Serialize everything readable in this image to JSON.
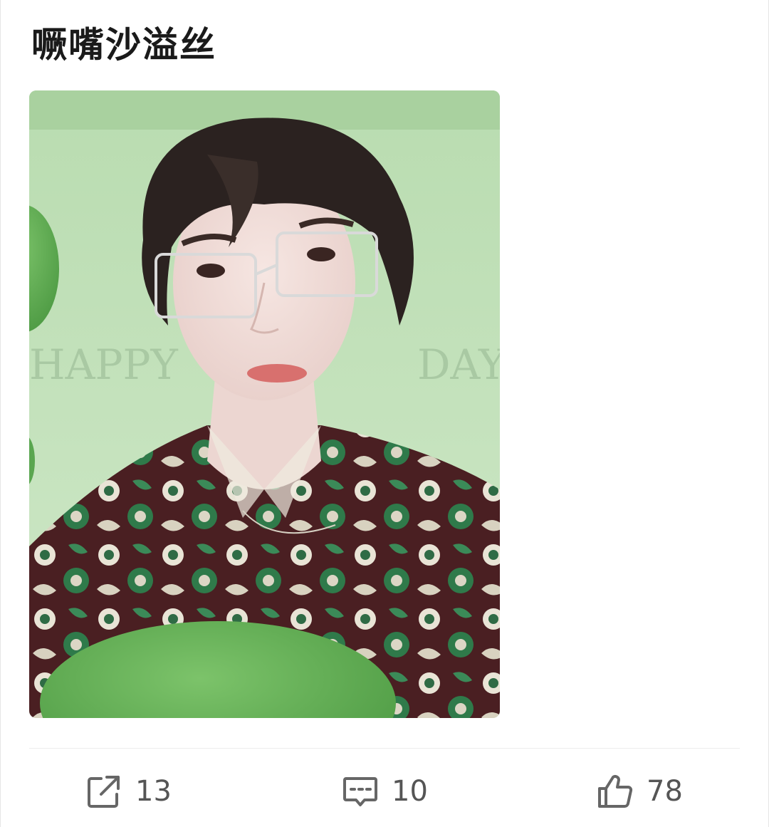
{
  "post": {
    "text": "噘嘴沙溢丝",
    "image": {
      "alt": "photo",
      "background_text_left": "HAPPY",
      "background_text_right": "DAY",
      "background_color": "#c8e3c0"
    }
  },
  "actions": {
    "repost": {
      "icon": "share-icon",
      "count": "13"
    },
    "comment": {
      "icon": "comment-icon",
      "count": "10"
    },
    "like": {
      "icon": "thumbs-up-icon",
      "count": "78"
    }
  },
  "colors": {
    "text": "#1a1a1a",
    "icon": "#666666",
    "divider": "#ececec"
  }
}
